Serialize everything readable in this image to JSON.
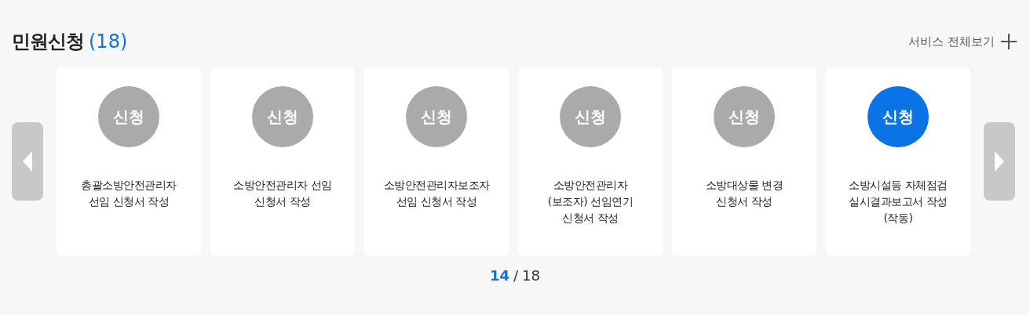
{
  "header": {
    "title": "민원신청",
    "count": "(18)",
    "more_link": "서비스 전체보기"
  },
  "cards": [
    {
      "badge": "신청",
      "title": "총괄소방안전관리자\n선임 신청서 작성",
      "selected": false
    },
    {
      "badge": "신청",
      "title": "소방안전관리자 선임\n신청서 작성",
      "selected": false
    },
    {
      "badge": "신청",
      "title": "소방안전관리자보조자\n선임 신청서 작성",
      "selected": false
    },
    {
      "badge": "신청",
      "title": "소방안전관리자\n(보조자) 선임연기\n신청서 작성",
      "selected": false
    },
    {
      "badge": "신청",
      "title": "소방대상물 변경\n신청서 작성",
      "selected": false
    },
    {
      "badge": "신청",
      "title": "소방시설등 자체점검\n실시결과보고서 작성\n(작동)",
      "selected": true
    }
  ],
  "pagination": {
    "current": "14",
    "separator": "/",
    "total": "18"
  }
}
